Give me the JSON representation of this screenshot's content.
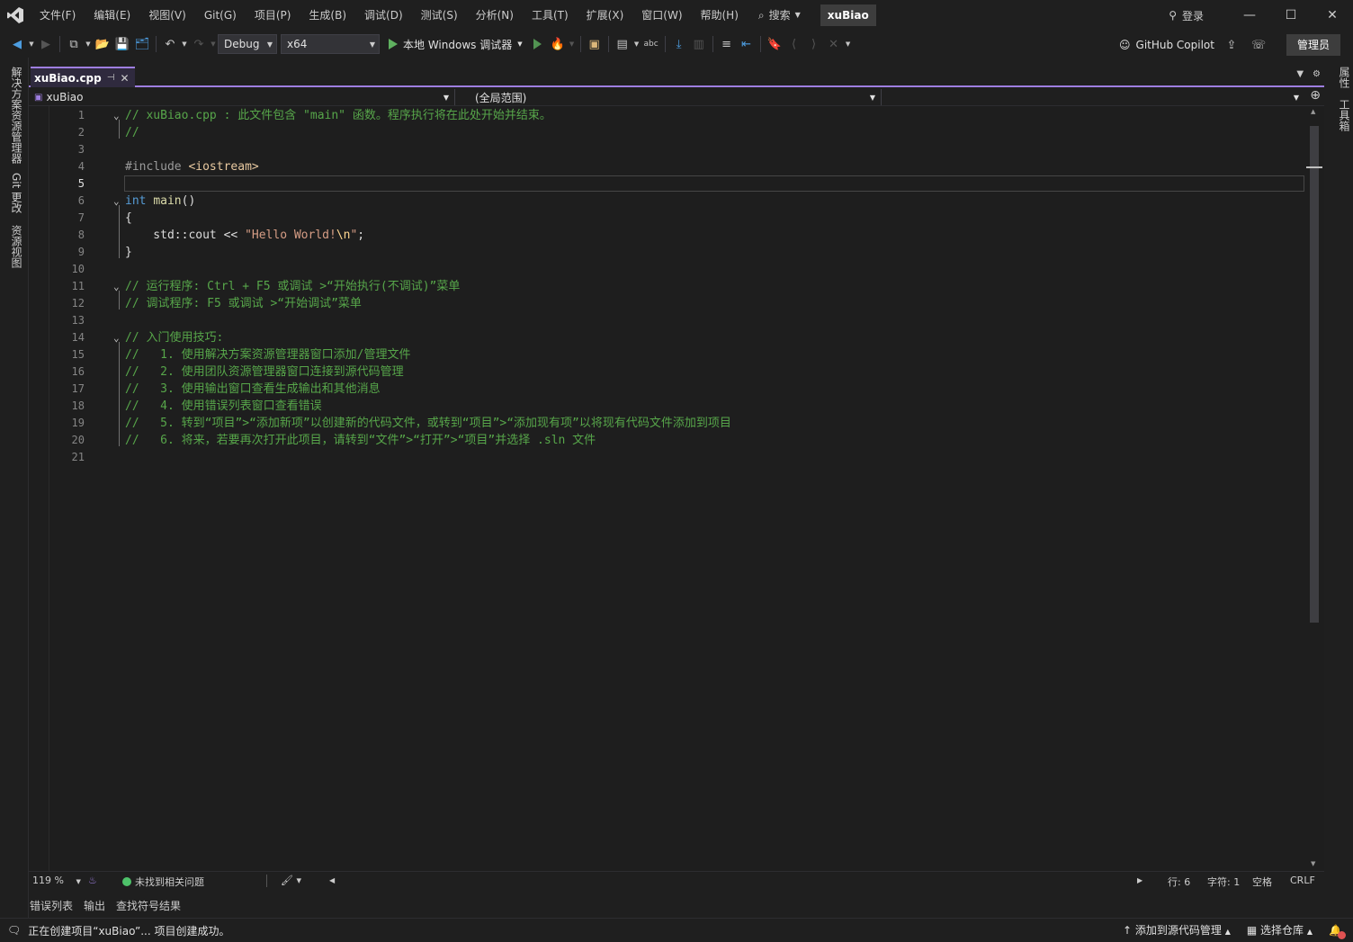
{
  "titlebar": {
    "menu": [
      "文件(F)",
      "编辑(E)",
      "视图(V)",
      "Git(G)",
      "项目(P)",
      "生成(B)",
      "调试(D)",
      "测试(S)",
      "分析(N)",
      "工具(T)",
      "扩展(X)",
      "窗口(W)",
      "帮助(H)"
    ],
    "search_label": "搜索",
    "solution_name": "xuBiao",
    "signin_label": "登录"
  },
  "toolbar": {
    "configuration": "Debug",
    "platform": "x64",
    "run_label": "本地 Windows 调试器",
    "copilot_label": "GitHub Copilot",
    "admin_label": "管理员"
  },
  "left_rail": {
    "tabs": [
      "解决方案资源管理器",
      "Git 更改",
      "资源视图"
    ]
  },
  "right_rail": {
    "tabs": [
      "属性",
      "工具箱"
    ]
  },
  "document": {
    "tab_name": "xuBiao.cpp",
    "nav_project": "xuBiao",
    "nav_scope": "(全局范围)",
    "active_line": 5
  },
  "code": {
    "lines": [
      {
        "n": "1",
        "parts": [
          [
            "com",
            "// xuBiao.cpp : 此文件包含 \"main\" 函数。程序执行将在此处开始并结束。"
          ]
        ]
      },
      {
        "n": "2",
        "parts": [
          [
            "com",
            "//"
          ]
        ]
      },
      {
        "n": "3",
        "parts": []
      },
      {
        "n": "4",
        "parts": [
          [
            "pre",
            "#include "
          ],
          [
            "inc",
            "<iostream>"
          ]
        ]
      },
      {
        "n": "5",
        "parts": []
      },
      {
        "n": "6",
        "parts": [
          [
            "kw",
            "int"
          ],
          [
            "txt",
            " "
          ],
          [
            "fn",
            "main"
          ],
          [
            "txt",
            "()"
          ]
        ]
      },
      {
        "n": "7",
        "parts": [
          [
            "txt",
            "{"
          ]
        ]
      },
      {
        "n": "8",
        "parts": [
          [
            "txt",
            "    std::cout << "
          ],
          [
            "str",
            "\"Hello World!"
          ],
          [
            "esc",
            "\\n"
          ],
          [
            "str",
            "\""
          ],
          [
            "txt",
            ";"
          ]
        ]
      },
      {
        "n": "9",
        "parts": [
          [
            "txt",
            "}"
          ]
        ]
      },
      {
        "n": "10",
        "parts": []
      },
      {
        "n": "11",
        "parts": [
          [
            "com",
            "// 运行程序: Ctrl + F5 或调试 >“开始执行(不调试)”菜单"
          ]
        ]
      },
      {
        "n": "12",
        "parts": [
          [
            "com",
            "// 调试程序: F5 或调试 >“开始调试”菜单"
          ]
        ]
      },
      {
        "n": "13",
        "parts": []
      },
      {
        "n": "14",
        "parts": [
          [
            "com",
            "// 入门使用技巧:"
          ]
        ]
      },
      {
        "n": "15",
        "parts": [
          [
            "com",
            "//   1. 使用解决方案资源管理器窗口添加/管理文件"
          ]
        ]
      },
      {
        "n": "16",
        "parts": [
          [
            "com",
            "//   2. 使用团队资源管理器窗口连接到源代码管理"
          ]
        ]
      },
      {
        "n": "17",
        "parts": [
          [
            "com",
            "//   3. 使用输出窗口查看生成输出和其他消息"
          ]
        ]
      },
      {
        "n": "18",
        "parts": [
          [
            "com",
            "//   4. 使用错误列表窗口查看错误"
          ]
        ]
      },
      {
        "n": "19",
        "parts": [
          [
            "com",
            "//   5. 转到“项目”>“添加新项”以创建新的代码文件，或转到“项目”>“添加现有项”以将现有代码文件添加到项目"
          ]
        ]
      },
      {
        "n": "20",
        "parts": [
          [
            "com",
            "//   6. 将来，若要再次打开此项目，请转到“文件”>“打开”>“项目”并选择 .sln 文件"
          ]
        ]
      },
      {
        "n": "21",
        "parts": []
      }
    ]
  },
  "editor_status": {
    "zoom": "119 %",
    "issues": "未找到相关问题",
    "line": "行: 6",
    "char": "字符: 1",
    "whitespace": "空格",
    "eol": "CRLF"
  },
  "bottom_tabs": [
    "错误列表",
    "输出",
    "查找符号结果"
  ],
  "statusbar": {
    "message": "正在创建项目“xuBiao”... 项目创建成功。",
    "source_control": "添加到源代码管理",
    "repo": "选择仓库"
  },
  "colors": {
    "accent": "#9e7ee0",
    "comment": "#57a64a",
    "keyword": "#569cd6",
    "function": "#dcdcaa",
    "string": "#d69d85"
  }
}
